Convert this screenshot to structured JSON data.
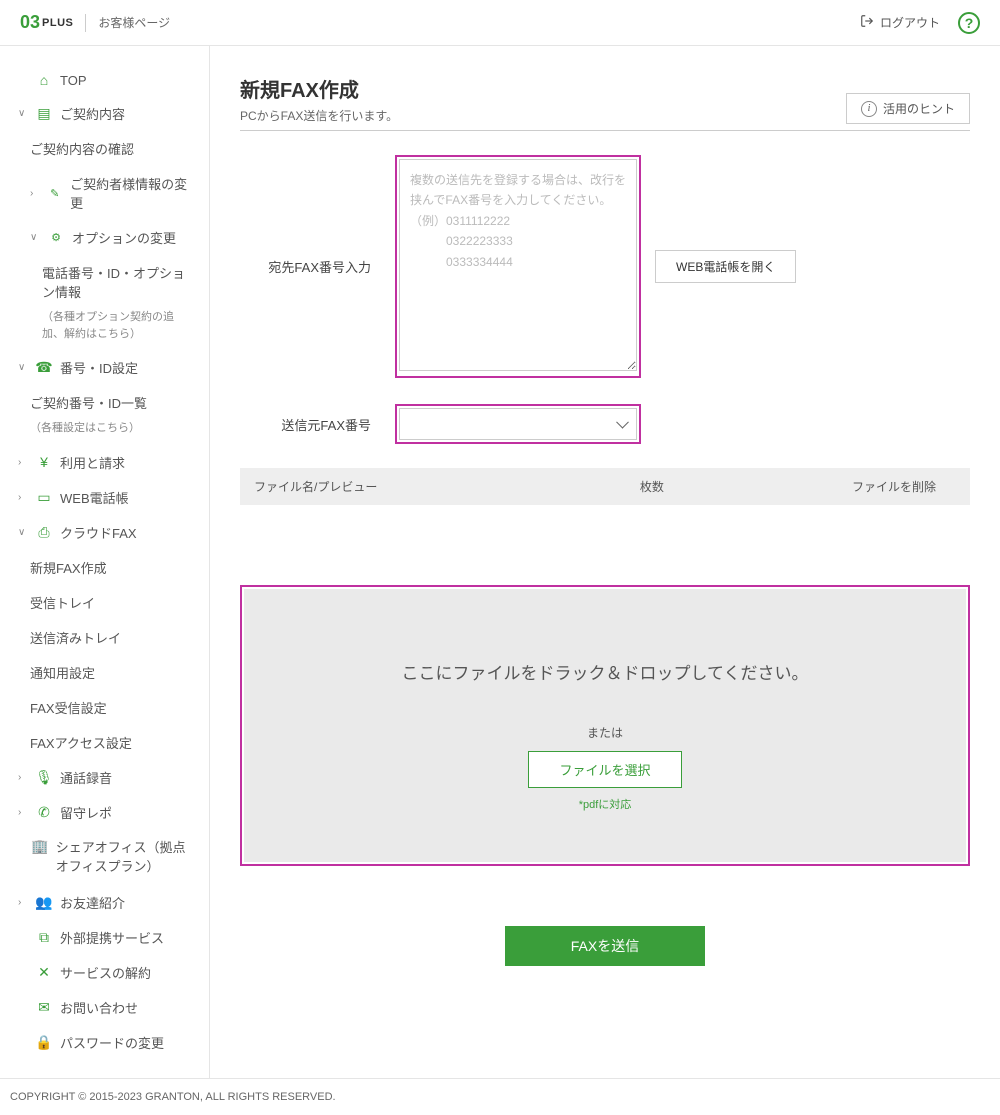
{
  "header": {
    "logo_brand": "03",
    "logo_suffix": "PLUS",
    "subtitle": "お客様ページ",
    "logout": "ログアウト",
    "help": "?"
  },
  "sidebar": {
    "top": "TOP",
    "contract": "ご契約内容",
    "contract_confirm": "ご契約内容の確認",
    "contractor_change": "ご契約者様情報の変更",
    "option_change": "オプションの変更",
    "phone_option": "電話番号・ID・オプション情報",
    "phone_option_note": "（各種オプション契約の追加、解約はこちら）",
    "number_id": "番号・ID設定",
    "number_id_list": "ご契約番号・ID一覧",
    "number_id_note": "（各種設定はこちら）",
    "billing": "利用と請求",
    "web_book": "WEB電話帳",
    "cloud_fax": "クラウドFAX",
    "new_fax": "新規FAX作成",
    "inbox": "受信トレイ",
    "sent": "送信済みトレイ",
    "notify": "通知用設定",
    "fax_recv": "FAX受信設定",
    "fax_access": "FAXアクセス設定",
    "call_rec": "通話録音",
    "rusu": "留守レポ",
    "share_office": "シェアオフィス（拠点オフィスプラン）",
    "referral": "お友達紹介",
    "external": "外部提携サービス",
    "cancel": "サービスの解約",
    "contact": "お問い合わせ",
    "password": "パスワードの変更"
  },
  "main": {
    "title": "新規FAX作成",
    "desc": "PCからFAX送信を行います。",
    "hint": "活用のヒント",
    "dest_label": "宛先FAX番号入力",
    "dest_placeholder": "複数の送信先を登録する場合は、改行を挟んでFAX番号を入力してください。\n（例）0311112222\n　　　0322223333\n　　　0333334444",
    "open_book": "WEB電話帳を開く",
    "sender_label": "送信元FAX番号",
    "th_file": "ファイル名/プレビュー",
    "th_pages": "枚数",
    "th_delete": "ファイルを削除",
    "dz_text": "ここにファイルをドラック＆ドロップしてください。",
    "dz_or": "または",
    "dz_select": "ファイルを選択",
    "dz_note": "*pdfに対応",
    "send": "FAXを送信"
  },
  "footer": {
    "copyright": "COPYRIGHT © 2015-2023 GRANTON, ALL RIGHTS RESERVED."
  }
}
